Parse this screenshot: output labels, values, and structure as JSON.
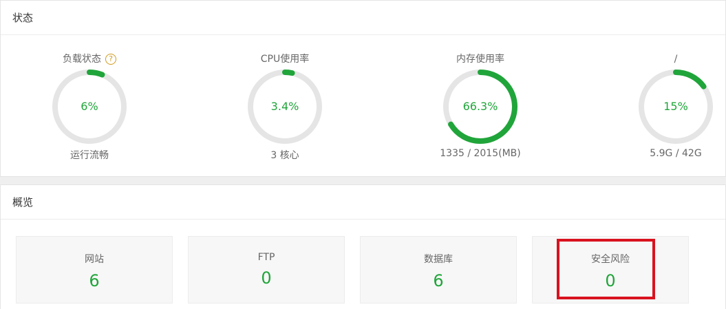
{
  "status_panel": {
    "title": "状态",
    "gauges": [
      {
        "label": "负载状态",
        "has_help": true,
        "help_glyph": "?",
        "value_text": "6%",
        "percent": 6,
        "sub": "运行流畅"
      },
      {
        "label": "CPU使用率",
        "has_help": false,
        "value_text": "3.4%",
        "percent": 3.4,
        "sub": "3 核心"
      },
      {
        "label": "内存使用率",
        "has_help": false,
        "value_text": "66.3%",
        "percent": 66.3,
        "sub": "1335 / 2015(MB)"
      },
      {
        "label": "/",
        "has_help": false,
        "value_text": "15%",
        "percent": 15,
        "sub": "5.9G / 42G"
      }
    ]
  },
  "overview_panel": {
    "title": "概览",
    "cards": [
      {
        "label": "网站",
        "value": "6"
      },
      {
        "label": "FTP",
        "value": "0"
      },
      {
        "label": "数据库",
        "value": "6"
      },
      {
        "label": "安全风险",
        "value": "0"
      }
    ]
  },
  "colors": {
    "accent_green": "#20a53a",
    "ring_track": "#e5e5e5",
    "help_orange": "#d29a1a",
    "highlight_red": "#d9121f"
  },
  "icons": {
    "help": "question-circle-icon"
  }
}
